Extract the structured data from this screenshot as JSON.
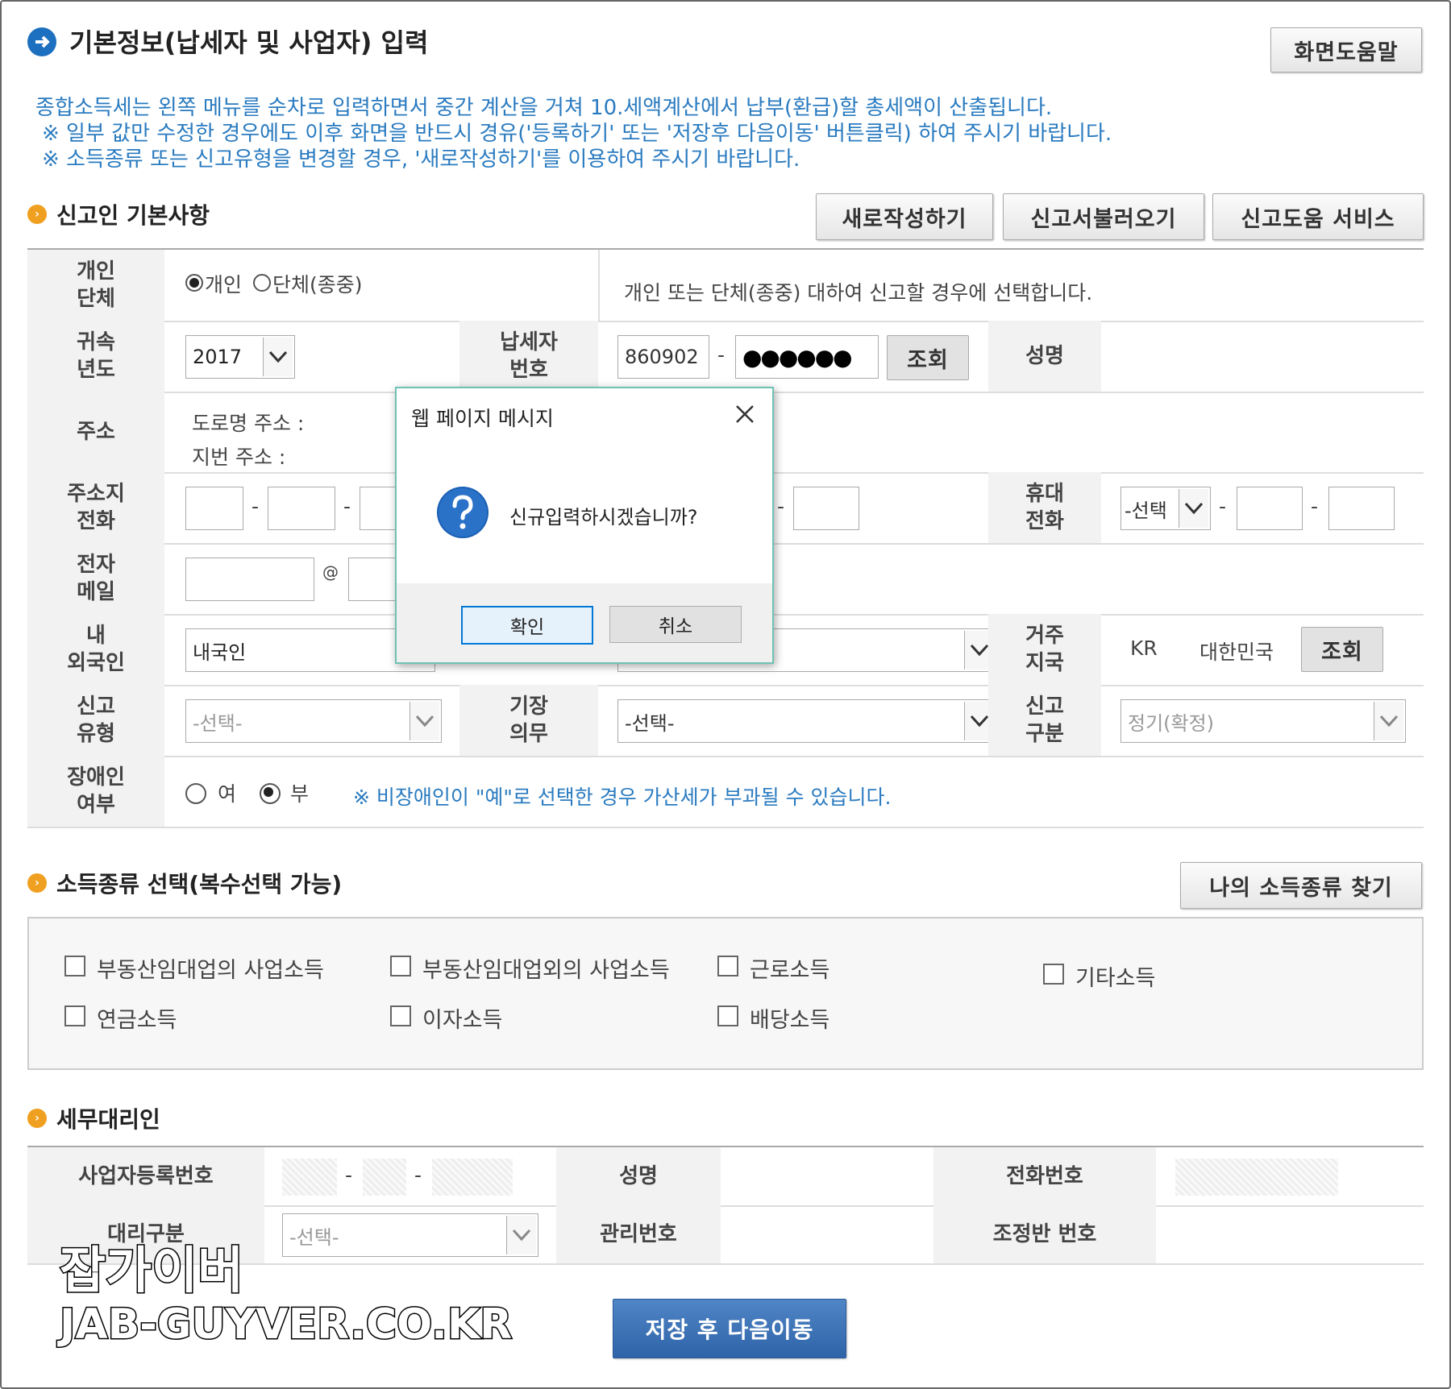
{
  "header": {
    "title": "기본정보(납세자 및 사업자) 입력",
    "help_button": "화면도움말"
  },
  "info_lines": [
    "종합소득세는 왼쪽 메뉴를 순차로 입력하면서 중간 계산을 거쳐 10.세액계산에서 납부(환급)할 총세액이 산출됩니다.",
    "※ 일부 값만 수정한 경우에도 이후 화면을 반드시 경유('등록하기' 또는 '저장후 다음이동' 버튼클릭) 하여 주시기 바랍니다.",
    "※ 소득종류 또는 신고유형을 변경할 경우, '새로작성하기'를 이용하여 주시기 바랍니다."
  ],
  "filer": {
    "title": "신고인 기본사항",
    "buttons": {
      "new": "새로작성하기",
      "load": "신고서불러오기",
      "service": "신고도움 서비스"
    },
    "labels": {
      "type": "개인\n단체",
      "year": "귀속\n년도",
      "taxpayer_no": "납세자\n번호",
      "name": "성명",
      "address": "주소",
      "home_phone": "주소지\n전화",
      "mobile": "휴대\n전화",
      "email": "전자\n메일",
      "nationality": "내\n외국인",
      "residence_country": "거주\n지국",
      "report_type": "신고\n유형",
      "bookkeeping": "기장\n의무",
      "report_class": "신고\n구분",
      "disabled": "장애인\n여부"
    },
    "type_options": [
      "개인",
      "단체(종중)"
    ],
    "type_desc": "개인 또는 단체(종중) 대하여 신고할 경우에 선택합니다.",
    "year": "2017",
    "ssn_front": "860902",
    "ssn_back": "●●●●●●",
    "lookup": "조회",
    "road_address": "도로명 주소 :",
    "lot_address": "지번 주소 :",
    "mobile_select": "-선택",
    "nationality_value": "내국인",
    "country_code": "KR",
    "country_name": "대한민국",
    "report_type_value": "-선택-",
    "bookkeeping_value": "-선택-",
    "report_class_value": "정기(확정)",
    "disabled_yes": "여",
    "disabled_no": "부",
    "disabled_note": "※ 비장애인이 \"예\"로 선택한 경우 가산세가 부과될 수 있습니다."
  },
  "income": {
    "title": "소득종류 선택(복수선택 가능)",
    "find_button": "나의 소득종류 찾기",
    "items": [
      "부동산임대업의 사업소득",
      "부동산임대업외의 사업소득",
      "근로소득",
      "기타소득",
      "연금소득",
      "이자소득",
      "배당소득"
    ]
  },
  "agent": {
    "title": "세무대리인",
    "labels": {
      "biz_no": "사업자등록번호",
      "name": "성명",
      "phone": "전화번호",
      "type": "대리구분",
      "mgmt_no": "관리번호",
      "team_no": "조정반 번호"
    },
    "type_value": "-선택-"
  },
  "save_button": "저장 후 다음이동",
  "dialog": {
    "title": "웹 페이지 메시지",
    "message": "신규입력하시겠습니까?",
    "ok": "확인",
    "cancel": "취소"
  },
  "watermark": {
    "line1": "잡가이버",
    "line2": "JAB-GUYVER.CO.KR"
  }
}
